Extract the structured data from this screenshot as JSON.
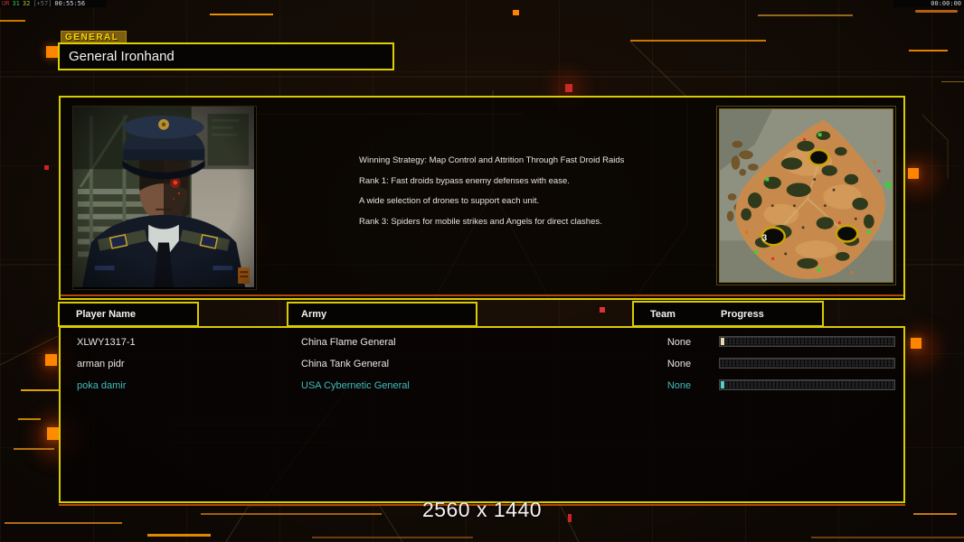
{
  "hud": {
    "debug_left": {
      "tokens": [
        {
          "text": "UR",
          "color": "#c03030"
        },
        {
          "text": "31",
          "color": "#3fc53f"
        },
        {
          "text": "32",
          "color": "#a8c530"
        },
        {
          "text": "[+57]",
          "color": "#6f6f6f"
        },
        {
          "text": "00:55:56",
          "color": "#d8d8d8"
        }
      ]
    },
    "clock_right": "00:00:00"
  },
  "general_tab": {
    "label": "GENERAL"
  },
  "name_input": {
    "value": "General Ironhand"
  },
  "strategy": {
    "lines": [
      "Winning Strategy: Map Control and Attrition Through Fast Droid Raids",
      "Rank 1: Fast droids bypass enemy defenses with ease.",
      "A wide selection of drones to support each unit.",
      "Rank 3: Spiders for mobile strikes and Angels for direct clashes."
    ]
  },
  "map_preview": {
    "start_position_label": "3"
  },
  "table": {
    "headers": {
      "player_name": "Player Name",
      "army": "Army",
      "team": "Team",
      "progress": "Progress"
    },
    "rows": [
      {
        "player": "XLWY1317-1",
        "army": "China Flame General",
        "team": "None",
        "progress_pct": 2,
        "text_color": "#e6e6e6",
        "tick_color": "#ead9b0"
      },
      {
        "player": "arman pidr",
        "army": "China Tank General",
        "team": "None",
        "progress_pct": 0,
        "text_color": "#e6e6e6",
        "tick_color": ""
      },
      {
        "player": "poka damir",
        "army": "USA Cybernetic General",
        "team": "None",
        "progress_pct": 2,
        "text_color": "#3fbdbd",
        "tick_color": "#55cfc9"
      }
    ]
  },
  "footer": {
    "resolution": "2560 x 1440"
  },
  "colors": {
    "accent_yellow": "#d8cb00",
    "accent_orange": "#ff8400",
    "accent_dark_orange": "#b34a00",
    "status_cyan": "#3fbdbd",
    "alert_red": "#cc2a2a"
  }
}
